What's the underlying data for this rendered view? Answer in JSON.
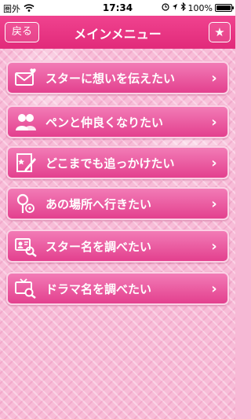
{
  "status_bar": {
    "carrier": "圏外",
    "time": "17:34",
    "battery_text": "100%",
    "battery_level": 1.0
  },
  "nav": {
    "back_label": "戻る",
    "title": "メインメニュー",
    "star_label": "★"
  },
  "menu": {
    "items": [
      {
        "label": "スターに想いを伝えたい",
        "icon": "envelope-icon"
      },
      {
        "label": "ペンと仲良くなりたい",
        "icon": "people-icon"
      },
      {
        "label": "どこまでも追っかけたい",
        "icon": "pen-note-icon"
      },
      {
        "label": "あの場所へ行きたい",
        "icon": "map-pin-icon"
      },
      {
        "label": "スター名を調べたい",
        "icon": "profile-search-icon"
      },
      {
        "label": "ドラマ名を調べたい",
        "icon": "tv-search-icon"
      }
    ]
  },
  "colors": {
    "nav_bg": "#e12a7a",
    "button_bg": "#e3408e",
    "background": "#f7bcd7"
  }
}
